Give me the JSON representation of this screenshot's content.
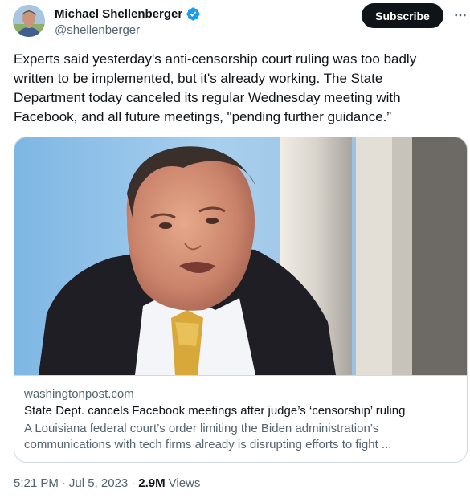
{
  "tweet": {
    "author": {
      "display_name": "Michael Shellenberger",
      "handle": "@shellenberger",
      "verified": true,
      "verified_color": "#1d9bf0"
    },
    "subscribe_label": "Subscribe",
    "text": "Experts said yesterday's anti-censorship court ruling was too badly written to be implemented, but it's already working. The State Department today canceled its regular Wednesday meeting with Facebook, and all future meetings, \"pending further guidance.”",
    "link_card": {
      "domain": "washingtonpost.com",
      "title": "State Dept. cancels Facebook meetings after judge’s ‘censorship’ ruling",
      "description": "A Louisiana federal court’s order limiting the Biden administration’s communications with tech firms already is disrupting efforts to fight ..."
    },
    "meta": {
      "time": "5:21 PM",
      "date": "Jul 5, 2023",
      "separator": "·",
      "views_count": "2.9M",
      "views_label": "Views"
    }
  },
  "icons": {
    "verified": "verified-badge-icon",
    "more": "more-horizontal-icon"
  }
}
